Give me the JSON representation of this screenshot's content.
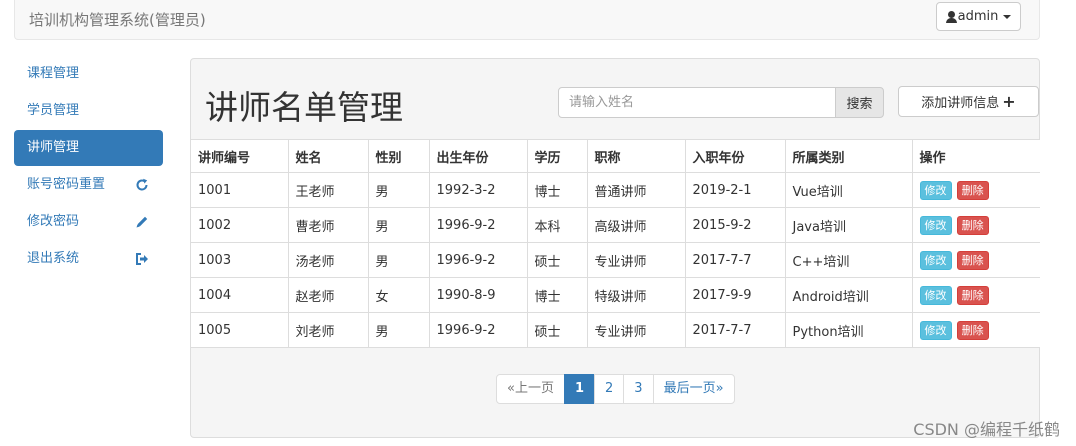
{
  "navbar": {
    "brand": "培训机构管理系统(管理员)",
    "user_label": "admin"
  },
  "sidebar": {
    "items": [
      {
        "label": "课程管理",
        "icon": ""
      },
      {
        "label": "学员管理",
        "icon": ""
      },
      {
        "label": "讲师管理",
        "icon": "",
        "active": true
      },
      {
        "label": "账号密码重置",
        "icon": "refresh-icon"
      },
      {
        "label": "修改密码",
        "icon": "pencil-icon"
      },
      {
        "label": "退出系统",
        "icon": "logout-icon"
      }
    ]
  },
  "main": {
    "title": "讲师名单管理",
    "search_placeholder": "请输入姓名",
    "search_label": "搜索",
    "add_label": "添加讲师信息",
    "table": {
      "headers": [
        "讲师编号",
        "姓名",
        "性别",
        "出生年份",
        "学历",
        "职称",
        "入职年份",
        "所属类别",
        "操作"
      ],
      "rows": [
        [
          "1001",
          "王老师",
          "男",
          "1992-3-2",
          "博士",
          "普通讲师",
          "2019-2-1",
          "Vue培训"
        ],
        [
          "1002",
          "曹老师",
          "男",
          "1996-9-2",
          "本科",
          "高级讲师",
          "2015-9-2",
          "Java培训"
        ],
        [
          "1003",
          "汤老师",
          "男",
          "1996-9-2",
          "硕士",
          "专业讲师",
          "2017-7-7",
          "C++培训"
        ],
        [
          "1004",
          "赵老师",
          "女",
          "1990-8-9",
          "博士",
          "特级讲师",
          "2017-9-9",
          "Android培训"
        ],
        [
          "1005",
          "刘老师",
          "男",
          "1996-9-2",
          "硕士",
          "专业讲师",
          "2017-7-7",
          "Python培训"
        ]
      ],
      "edit_label": "修改",
      "delete_label": "删除"
    },
    "pagination": {
      "prev": "«上一页",
      "pages": [
        "1",
        "2",
        "3"
      ],
      "current": "1",
      "last": "最后一页»"
    }
  },
  "watermark": "CSDN @编程千纸鹤",
  "colors": {
    "primary": "#337ab7",
    "info": "#5bc0de",
    "danger": "#d9534f"
  }
}
